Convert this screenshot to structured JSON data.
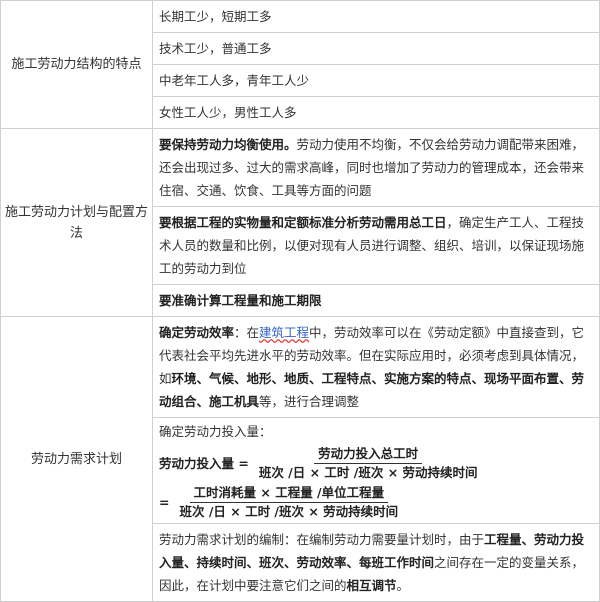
{
  "structure": {
    "label": "施工劳动力结构的特点",
    "items": [
      "长期工少，短期工多",
      "技术工少，普通工多",
      "中老年工人多，青年工人少",
      "女性工人少，男性工人多"
    ]
  },
  "plan": {
    "label": "施工劳动力计划与配置方法",
    "p1_bold": "要保持劳动力均衡使用。",
    "p1_rest": "劳动力使用不均衡，不仅会给劳动力调配带来困难，还会出现过多、过大的需求高峰，同时也增加了劳动力的管理成本，还会带来住宿、交通、饮食、工具等方面的问题",
    "p2_bold": "要根据工程的实物量和定额标准分析劳动需用总工日",
    "p2_rest": "，确定生产工人、工程技术人员的数量和比例，以便对现有人员进行调整、组织、培训，以保证现场施工的劳动力到位",
    "p3_bold": "要准确计算工程量和施工期限"
  },
  "demand": {
    "label": "劳动力需求计划",
    "eff_bold": "确定劳动效率",
    "eff_a": "：在",
    "eff_link": "建筑工程",
    "eff_b": "中，劳动效率可以在《劳动定额》中直接查到，它代表社会平均先进水平的劳动效率。但在实际应用时，必须考虑到具体情况，如",
    "eff_c_bold": "环境、气候、地形、地质、工程特点、实施方案的特点、现场平面布置、劳动组合、施工机具",
    "eff_d": "等，进行合理调整",
    "input_title": "确定劳动力投入量：",
    "f1_left": "劳动力投入量 =",
    "f1_num": "劳动力投入总工时",
    "f1_den": "班次 /日 × 工时 /班次 × 劳动持续时间",
    "f2_left": "=",
    "f2_num": "工时消耗量 × 工程量 /单位工程量",
    "f2_den": "班次 /日 × 工时 /班次 × 劳动持续时间",
    "prep_a": "劳动力需求计划的编制：在编制劳动力需要量计划时，由于",
    "prep_b_bold": "工程量、劳动力投入量、持续时间、班次、劳动效率、每班工作时间",
    "prep_c": "之间存在一定的变量关系，因此，在计划中要注意它们之间的",
    "prep_d_bold": "相互调节",
    "prep_e": "。"
  }
}
